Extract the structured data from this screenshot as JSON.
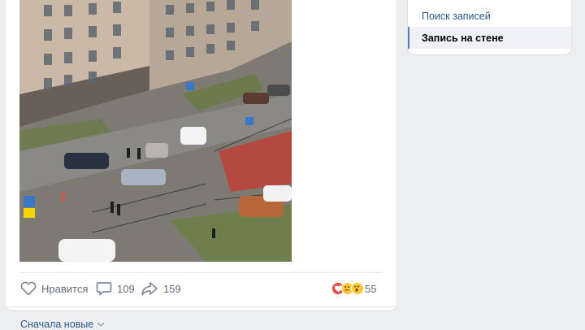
{
  "post": {
    "actions": {
      "like_label": "Нравится",
      "comments_count": "109",
      "shares_count": "159",
      "reactions_count": "55"
    },
    "reactions": [
      "heart-reaction",
      "sad-reaction",
      "wow-reaction"
    ],
    "comments_sort": "Сначала новые"
  },
  "sidebar_menu": {
    "items": [
      {
        "label": "Поиск записей",
        "active": false
      },
      {
        "label": "Запись на стене",
        "active": true
      }
    ]
  },
  "colors": {
    "link": "#2a5885",
    "accent": "#5181b8",
    "muted": "#626d7a",
    "heart": "#e64646",
    "emoji": "#ffc93b"
  }
}
